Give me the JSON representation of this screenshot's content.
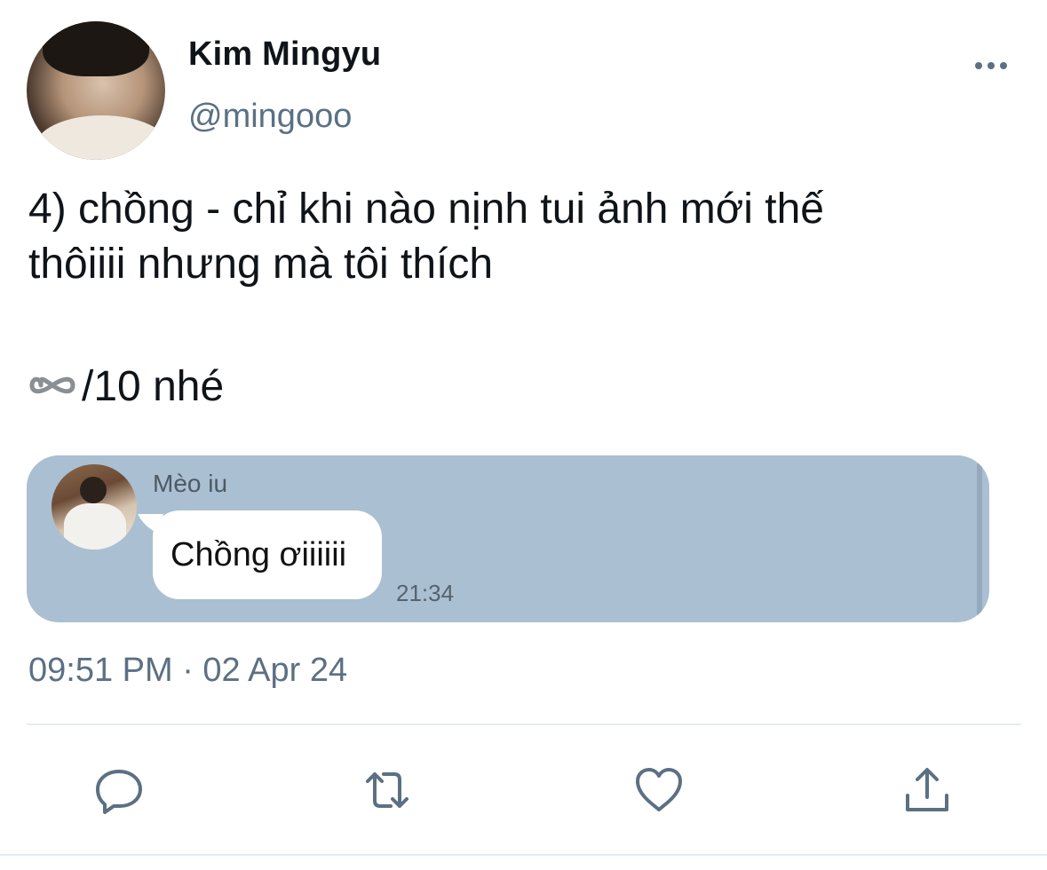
{
  "author": {
    "display_name": "Kim Mingyu",
    "handle": "@mingooo",
    "avatar_icon": "profile-photo"
  },
  "tweet": {
    "line1": "4) chồng - chỉ khi nào nịnh tui ảnh mới thế",
    "line2": "thôiiii nhưng mà tôi thích",
    "line3_icon": "infinity-emoji",
    "line3_text": "/10 nhé",
    "timestamp": "09:51 PM · 02 Apr 24"
  },
  "media": {
    "background_color": "#aabfd2",
    "chat": {
      "sender": "Mèo iu",
      "message": "Chồng ơiiiiii",
      "time": "21:34"
    }
  },
  "actions": {
    "reply_icon": "reply-icon",
    "retweet_icon": "retweet-icon",
    "like_icon": "heart-icon",
    "share_icon": "share-icon"
  },
  "colors": {
    "text_primary": "#0f1419",
    "text_secondary": "#5b7083",
    "divider": "#e6ecf0"
  }
}
